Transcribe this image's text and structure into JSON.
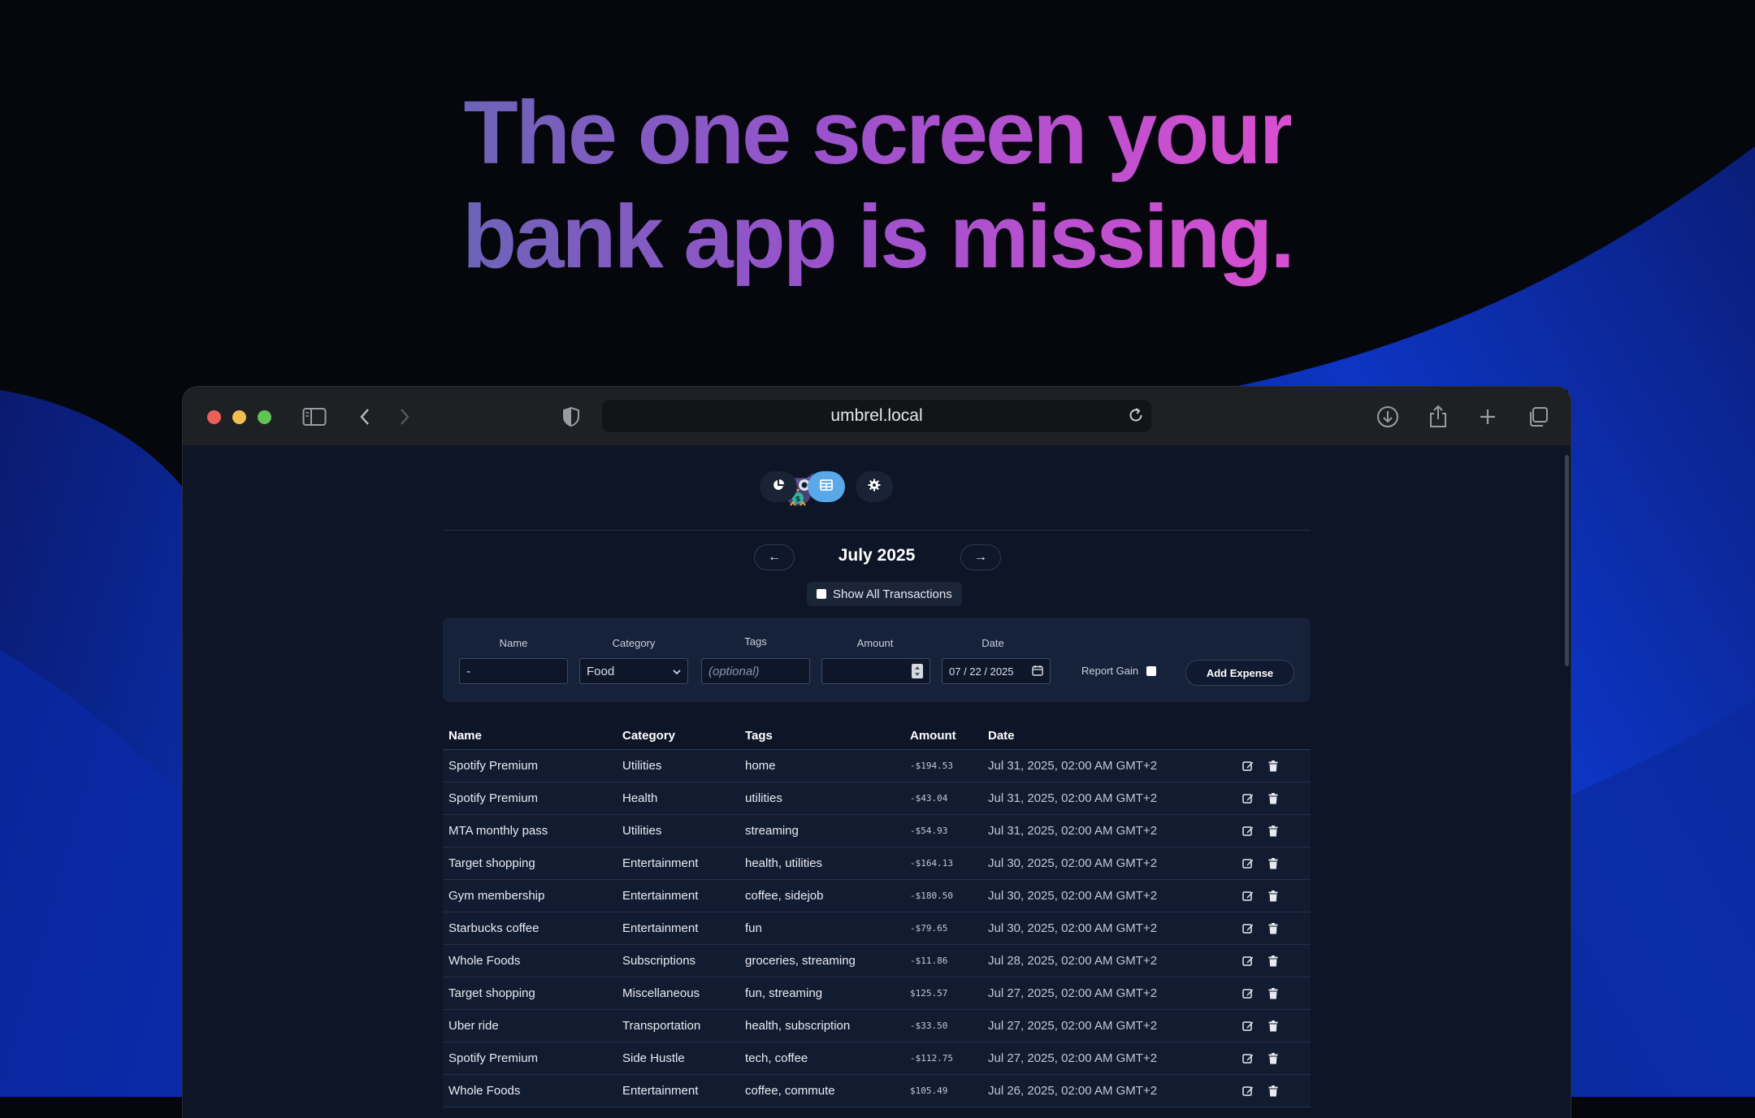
{
  "headline": {
    "line1": "The one screen your",
    "line2": "bank app is missing."
  },
  "browser": {
    "url": "umbrel.local",
    "icons": [
      "sidebar-icon",
      "back-icon",
      "forward-icon",
      "shield-icon",
      "reload-icon",
      "download-icon",
      "share-icon",
      "new-tab-icon",
      "tabs-overview-icon"
    ],
    "traffic_colors": [
      "#ec5f57",
      "#f4bd4f",
      "#5fc454"
    ]
  },
  "app": {
    "nav": {
      "icons": [
        "owl-logo-icon",
        "pie-chart-icon",
        "table-icon",
        "gear-icon"
      ],
      "active_color": "#5aa8e8"
    },
    "month_title": "July 2025",
    "prev_icon": "←",
    "next_icon": "→",
    "show_all_label": "Show All Transactions",
    "form": {
      "labels": {
        "name": "Name",
        "category": "Category",
        "tags": "Tags",
        "amount": "Amount",
        "date": "Date"
      },
      "name_value": "-",
      "category_value": "Food",
      "tags_placeholder": "(optional)",
      "amount_value": "",
      "date_value": "07 / 22 / 2025",
      "report_gain_label": "Report Gain",
      "add_button_label": "Add Expense"
    },
    "table": {
      "headers": [
        "Name",
        "Category",
        "Tags",
        "Amount",
        "Date"
      ],
      "rows": [
        {
          "name": "Spotify Premium",
          "category": "Utilities",
          "tags": "home",
          "amount": "-$194.53",
          "date": "Jul 31, 2025, 02:00 AM GMT+2"
        },
        {
          "name": "Spotify Premium",
          "category": "Health",
          "tags": "utilities",
          "amount": "-$43.04",
          "date": "Jul 31, 2025, 02:00 AM GMT+2"
        },
        {
          "name": "MTA monthly pass",
          "category": "Utilities",
          "tags": "streaming",
          "amount": "-$54.93",
          "date": "Jul 31, 2025, 02:00 AM GMT+2"
        },
        {
          "name": "Target shopping",
          "category": "Entertainment",
          "tags": "health, utilities",
          "amount": "-$164.13",
          "date": "Jul 30, 2025, 02:00 AM GMT+2"
        },
        {
          "name": "Gym membership",
          "category": "Entertainment",
          "tags": "coffee, sidejob",
          "amount": "-$180.50",
          "date": "Jul 30, 2025, 02:00 AM GMT+2"
        },
        {
          "name": "Starbucks coffee",
          "category": "Entertainment",
          "tags": "fun",
          "amount": "-$79.65",
          "date": "Jul 30, 2025, 02:00 AM GMT+2"
        },
        {
          "name": "Whole Foods",
          "category": "Subscriptions",
          "tags": "groceries, streaming",
          "amount": "-$11.86",
          "date": "Jul 28, 2025, 02:00 AM GMT+2"
        },
        {
          "name": "Target shopping",
          "category": "Miscellaneous",
          "tags": "fun, streaming",
          "amount": "$125.57",
          "date": "Jul 27, 2025, 02:00 AM GMT+2"
        },
        {
          "name": "Uber ride",
          "category": "Transportation",
          "tags": "health, subscription",
          "amount": "-$33.50",
          "date": "Jul 27, 2025, 02:00 AM GMT+2"
        },
        {
          "name": "Spotify Premium",
          "category": "Side Hustle",
          "tags": "tech, coffee",
          "amount": "-$112.75",
          "date": "Jul 27, 2025, 02:00 AM GMT+2"
        },
        {
          "name": "Whole Foods",
          "category": "Entertainment",
          "tags": "coffee, commute",
          "amount": "$105.49",
          "date": "Jul 26, 2025, 02:00 AM GMT+2"
        }
      ]
    }
  }
}
